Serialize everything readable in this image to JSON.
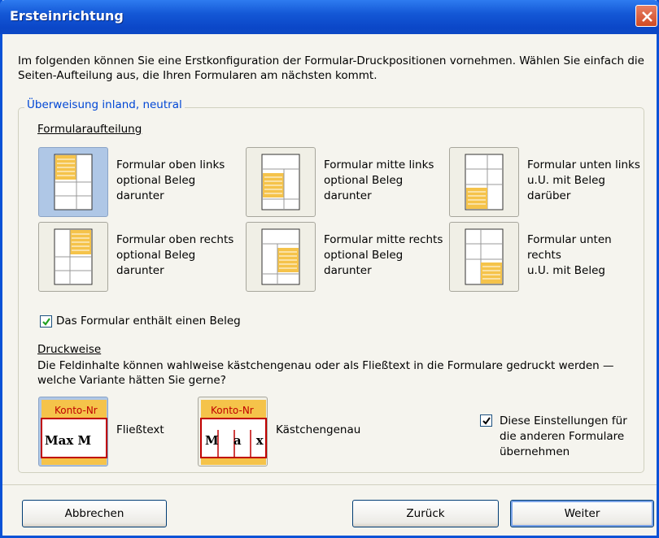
{
  "window": {
    "title": "Ersteinrichtung"
  },
  "intro": "Im folgenden können Sie eine Erstkonfiguration der Formular-Druckpositionen vornehmen. Wählen Sie einfach die Seiten-Aufteilung aus, die Ihren Formularen am nächsten kommt.",
  "group": {
    "legend": "Überweisung inland, neutral"
  },
  "layout_section": {
    "label": "Formularaufteilung",
    "options": [
      {
        "label": "Formular oben links\noptional Beleg\ndarunter",
        "selected": true
      },
      {
        "label": "Formular mitte links\noptional Beleg\ndarunter",
        "selected": false
      },
      {
        "label": "Formular unten links\nu.U. mit Beleg\ndarüber",
        "selected": false
      },
      {
        "label": "Formular oben rechts\noptional Beleg\ndarunter",
        "selected": false
      },
      {
        "label": "Formular mitte rechts\noptional Beleg\ndarunter",
        "selected": false
      },
      {
        "label": "Formular unten\nrechts\nu.U. mit Beleg",
        "selected": false
      }
    ]
  },
  "beleg_checkbox": {
    "label": "Das Formular enthält einen Beleg",
    "checked": true
  },
  "print_section": {
    "label": "Druckweise",
    "description": "Die Feldinhalte können wahlweise kästchengenau oder als Fließtext in die Formulare gedruckt werden — welche Variante hätten Sie gerne?",
    "icon_caption": "Konto-Nr",
    "modes": [
      {
        "label": "Fließtext",
        "sample": "Max M",
        "selected": true
      },
      {
        "label": "Kästchengenau",
        "sample": "M a x",
        "selected": false
      }
    ]
  },
  "apply_checkbox": {
    "label": "Diese Einstellungen für\ndie anderen Formulare\nübernehmen",
    "checked": true
  },
  "buttons": {
    "cancel": "Abbrechen",
    "back": "Zurück",
    "next": "Weiter"
  },
  "colors": {
    "title_bar": "#0B47C8",
    "legend_text": "#0046D5",
    "selected_tile": "#AFC7E6",
    "form_highlight": "#F5C34A",
    "checkbox_green": "#21A121"
  }
}
